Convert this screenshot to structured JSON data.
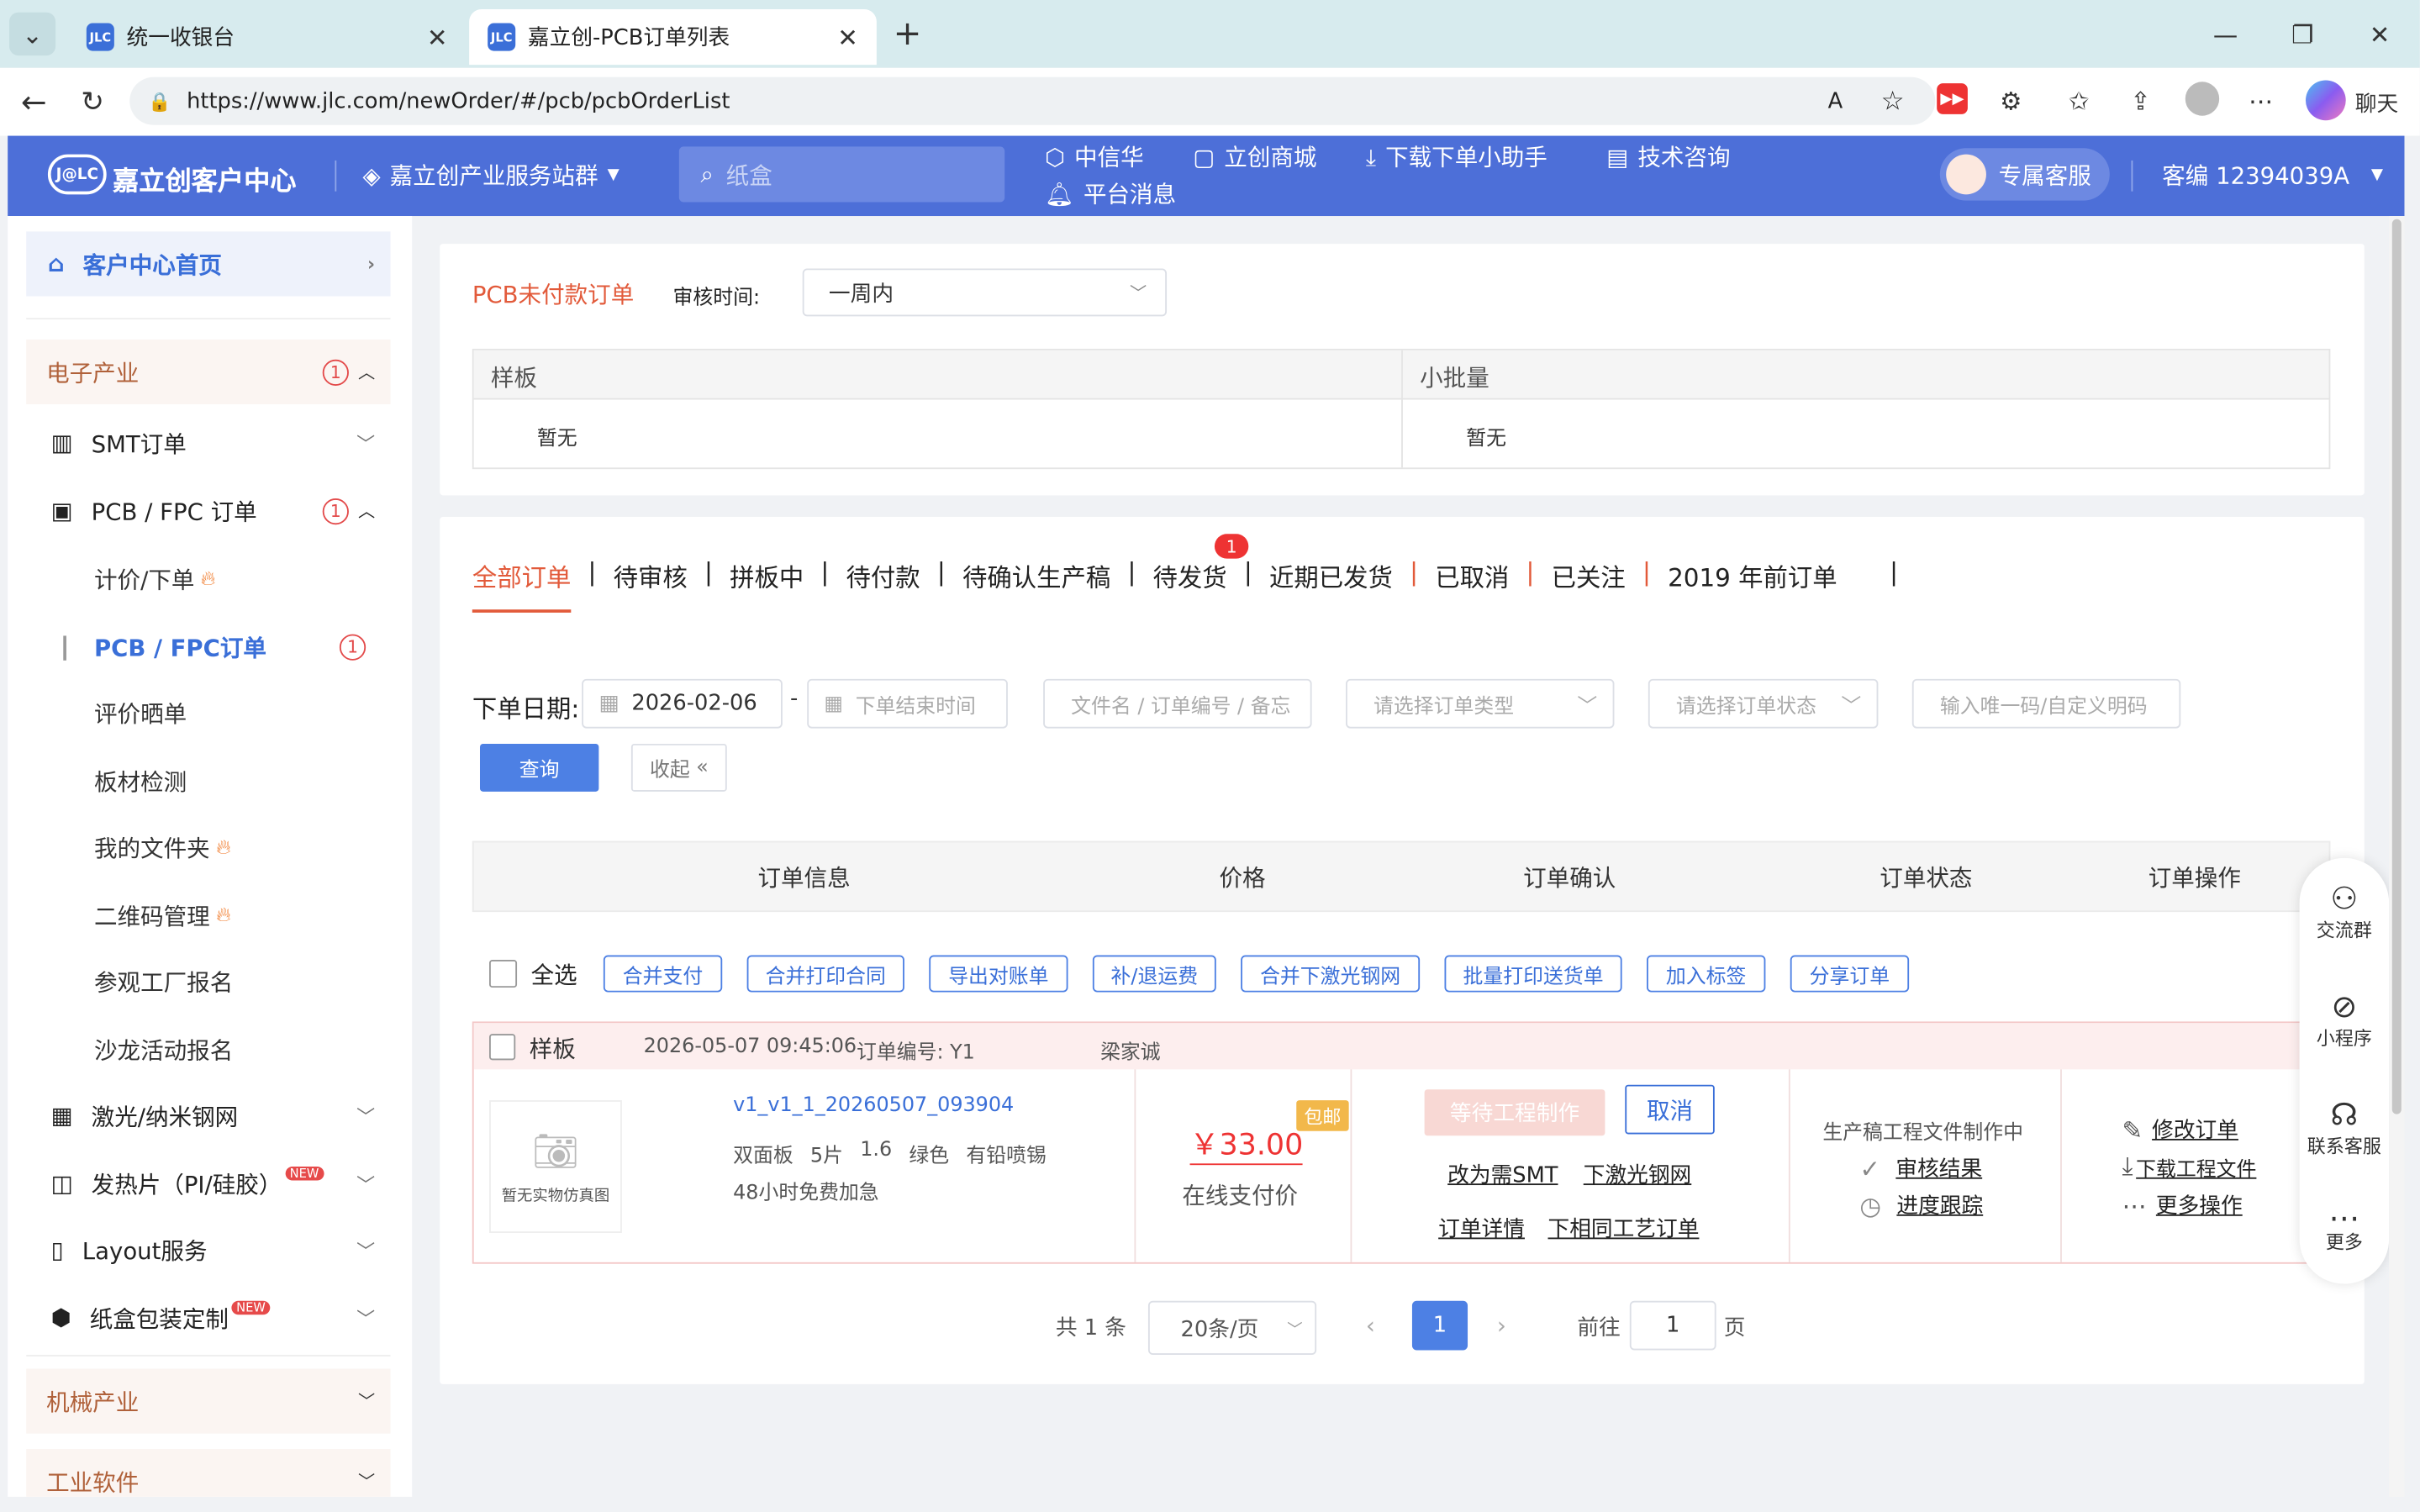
{
  "browser": {
    "tabs": [
      {
        "label": "统一收银台"
      },
      {
        "label": "嘉立创-PCB订单列表"
      }
    ],
    "url": "https://www.jlc.com/newOrder/#/pcb/pcbOrderList",
    "chat_label": "聊天",
    "favicon": "JLC"
  },
  "header": {
    "logo": "J@LC",
    "title": "嘉立创客户中心",
    "station": "嘉立创产业服务站群",
    "search_placeholder": "纸盒",
    "links": [
      {
        "label": "中信华"
      },
      {
        "label": "立创商城"
      },
      {
        "label": "下载下单小助手"
      },
      {
        "label": "技术咨询"
      },
      {
        "label": "平台消息"
      }
    ],
    "service": "专属客服",
    "customer": "客编 12394039A"
  },
  "sidebar": {
    "home": "客户中心首页",
    "groups": [
      {
        "label": "电子产业",
        "badge": "1"
      },
      {
        "label": "机械产业"
      },
      {
        "label": "工业软件"
      }
    ],
    "items": [
      {
        "label": "SMT订单"
      },
      {
        "label": "PCB / FPC 订单",
        "badge": "1"
      },
      {
        "label": "激光/纳米钢网"
      },
      {
        "label": "发热片（PI/硅胶）",
        "new": "NEW"
      },
      {
        "label": "Layout服务"
      },
      {
        "label": "纸盒包装定制",
        "new": "NEW"
      }
    ],
    "subitems": [
      {
        "label": "计价/下单"
      },
      {
        "label": "PCB / FPC订单",
        "badge": "1"
      },
      {
        "label": "评价晒单"
      },
      {
        "label": "板材检测"
      },
      {
        "label": "我的文件夹"
      },
      {
        "label": "二维码管理"
      },
      {
        "label": "参观工厂报名"
      },
      {
        "label": "沙龙活动报名"
      }
    ]
  },
  "unpaid": {
    "title": "PCB未付款订单",
    "review_label": "审核时间:",
    "review_value": "一周内",
    "col1": "样板",
    "col2": "小批量",
    "empty1": "暂无",
    "empty2": "暂无"
  },
  "tabs": [
    {
      "label": "全部订单"
    },
    {
      "label": "待审核"
    },
    {
      "label": "拼板中"
    },
    {
      "label": "待付款"
    },
    {
      "label": "待确认生产稿"
    },
    {
      "label": "待发货",
      "badge": "1"
    },
    {
      "label": "近期已发货"
    },
    {
      "label": "已取消"
    },
    {
      "label": "已关注"
    },
    {
      "label": "2019 年前订单"
    }
  ],
  "filters": {
    "date_label": "下单日期:",
    "date_start": "2026-02-06",
    "date_end_ph": "下单结束时间",
    "file_ph": "文件名 / 订单编号 / 备忘",
    "type_ph": "请选择订单类型",
    "status_ph": "请选择订单状态",
    "code_ph": "输入唯一码/自定义明码",
    "query": "查询",
    "collapse": "收起"
  },
  "table": {
    "headers": [
      "订单信息",
      "价格",
      "订单确认",
      "订单状态",
      "订单操作"
    ],
    "select_all": "全选",
    "batch": [
      "合并支付",
      "合并打印合同",
      "导出对账单",
      "补/退运费",
      "合并下激光钢网",
      "批量打印送货单",
      "加入标签",
      "分享订单"
    ]
  },
  "order": {
    "type": "样板",
    "time": "2026-05-07 09:45:06",
    "no_label": "订单编号: Y1",
    "user": "梁家诚",
    "file": "v1_v1_1_20260507_093904",
    "specs": [
      "双面板",
      "5片",
      "1.6",
      "绿色",
      "有铅喷锡"
    ],
    "urgent": "48小时免费加急",
    "no_photo": "暂无实物仿真图",
    "price": "￥33.00",
    "free_ship": "包邮",
    "pay_method": "在线支付价",
    "waiting": "等待工程制作",
    "cancel": "取消",
    "to_smt": "改为需SMT",
    "laser": "下激光钢网",
    "detail": "订单详情",
    "same": "下相同工艺订单",
    "status": "生产稿工程文件制作中",
    "review": "审核结果",
    "track": "进度跟踪",
    "modify": "修改订单",
    "download": "下载工程文件",
    "more": "更多操作"
  },
  "pagination": {
    "total": "共 1 条",
    "size": "20条/页",
    "page": "1",
    "goto": "前往",
    "goto_val": "1",
    "unit": "页"
  },
  "float": [
    {
      "label": "交流群"
    },
    {
      "label": "小程序"
    },
    {
      "label": "联系客服"
    },
    {
      "label": "更多"
    }
  ]
}
